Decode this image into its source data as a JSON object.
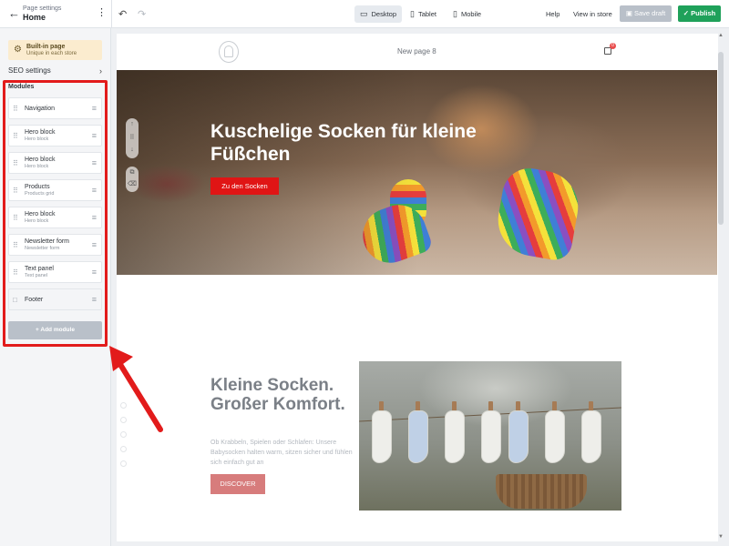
{
  "topbar": {
    "page_settings_label": "Page settings",
    "page_name": "Home",
    "devices": [
      {
        "label": "Desktop",
        "icon": "monitor-icon",
        "active": true
      },
      {
        "label": "Tablet",
        "icon": "tablet-icon",
        "active": false
      },
      {
        "label": "Mobile",
        "icon": "mobile-icon",
        "active": false
      }
    ],
    "help_label": "Help",
    "view_in_store_label": "View in store",
    "save_draft_label": "Save draft",
    "publish_label": "Publish"
  },
  "sidebar": {
    "builtin_title": "Built-in page",
    "builtin_subtitle": "Unique in each store",
    "seo_label": "SEO settings",
    "modules_label": "Modules",
    "modules": [
      {
        "title": "Navigation",
        "subtitle": ""
      },
      {
        "title": "Hero block",
        "subtitle": "Hero block"
      },
      {
        "title": "Hero block",
        "subtitle": "Hero block"
      },
      {
        "title": "Products",
        "subtitle": "Products grid"
      },
      {
        "title": "Hero block",
        "subtitle": "Hero block"
      },
      {
        "title": "Newsletter form",
        "subtitle": "Newsletter form"
      },
      {
        "title": "Text panel",
        "subtitle": "Text panel"
      },
      {
        "title": "Footer",
        "subtitle": ""
      }
    ],
    "add_module_label": "+ Add module"
  },
  "preview": {
    "nav_title": "New page 8",
    "cart_count": "0",
    "hero_heading": "Kuschelige Socken für kleine Füßchen",
    "hero_button": "Zu den Socken",
    "section_heading": "Kleine Socken. Großer Komfort.",
    "section_body": "Ob Krabbeln, Spielen oder Schlafen: Unsere Babysocken halten warm, sitzen sicher und fühlen sich einfach gut an",
    "section_button": "DISCOVER"
  },
  "colors": {
    "publish": "#1fa15a",
    "highlight": "#e21b1b",
    "hero_button": "#e01515",
    "discover_button": "#d77c7c"
  }
}
